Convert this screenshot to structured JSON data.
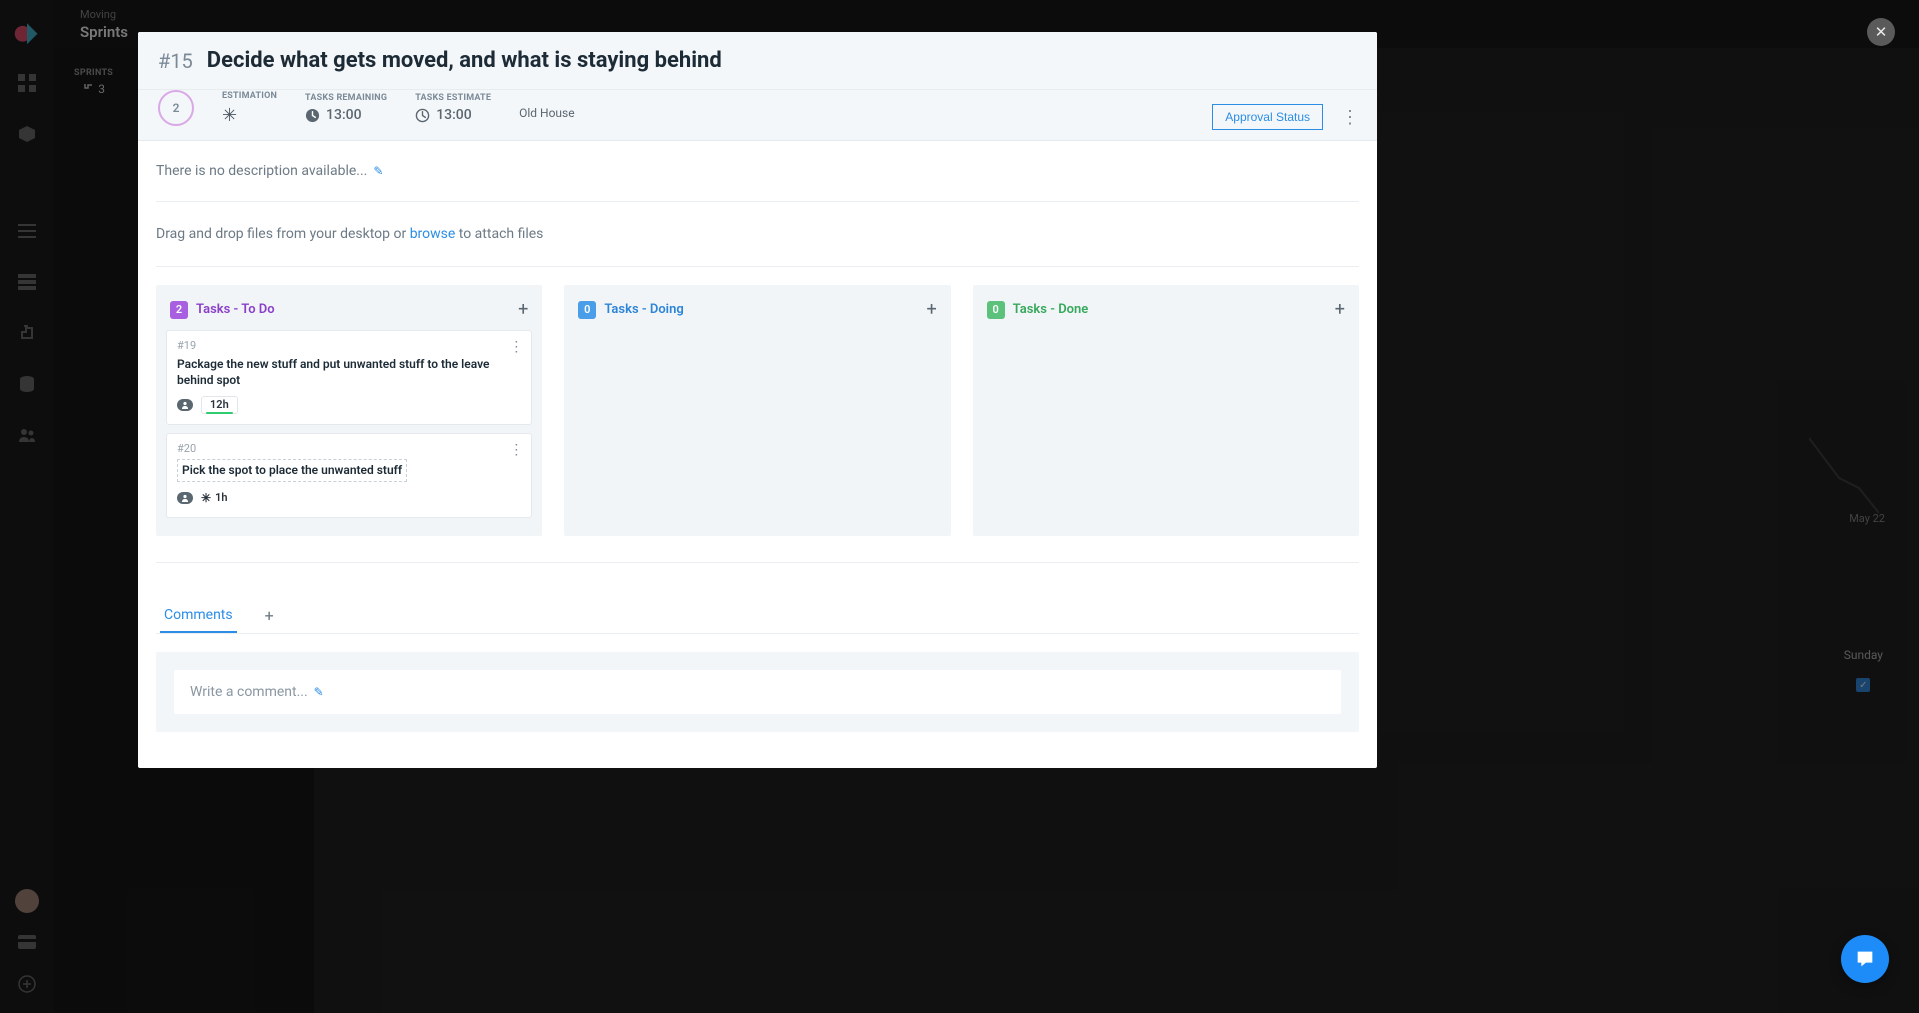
{
  "header": {
    "project": "Moving",
    "section": "Sprints"
  },
  "subpanel": {
    "sprints_label": "SPRINTS",
    "sprints_val": "3"
  },
  "bg": {
    "chart_label": "May 22",
    "sunday": "Sunday"
  },
  "modal": {
    "seq": "#15",
    "title": "Decide what gets moved, and what is staying behind",
    "est_circle": "2",
    "labels": {
      "estimation": "ESTIMATION",
      "tasks_remaining": "TASKS REMAINING",
      "tasks_estimate": "TASKS ESTIMATE"
    },
    "tasks_remaining": "13:00",
    "tasks_estimate": "13:00",
    "tag": "Old House",
    "approval": "Approval Status",
    "description_placeholder": "There is no description available...",
    "dropzone_pre": "Drag and drop files from your desktop or ",
    "dropzone_browse": "browse",
    "dropzone_post": " to attach files",
    "columns": [
      {
        "count": "2",
        "title": "Tasks - To Do",
        "color": "purple",
        "cards": [
          {
            "id": "#19",
            "title": "Package the new stuff and put unwanted stuff to the leave behind spot",
            "time": "12h",
            "time_style": "underline"
          },
          {
            "id": "#20",
            "title": "Pick the spot to place the unwanted stuff",
            "time": "1h",
            "time_style": "snow"
          }
        ]
      },
      {
        "count": "0",
        "title": "Tasks - Doing",
        "color": "blue",
        "cards": []
      },
      {
        "count": "0",
        "title": "Tasks - Done",
        "color": "green",
        "cards": []
      }
    ],
    "tabs": {
      "comments": "Comments"
    },
    "comment_placeholder": "Write a comment..."
  }
}
